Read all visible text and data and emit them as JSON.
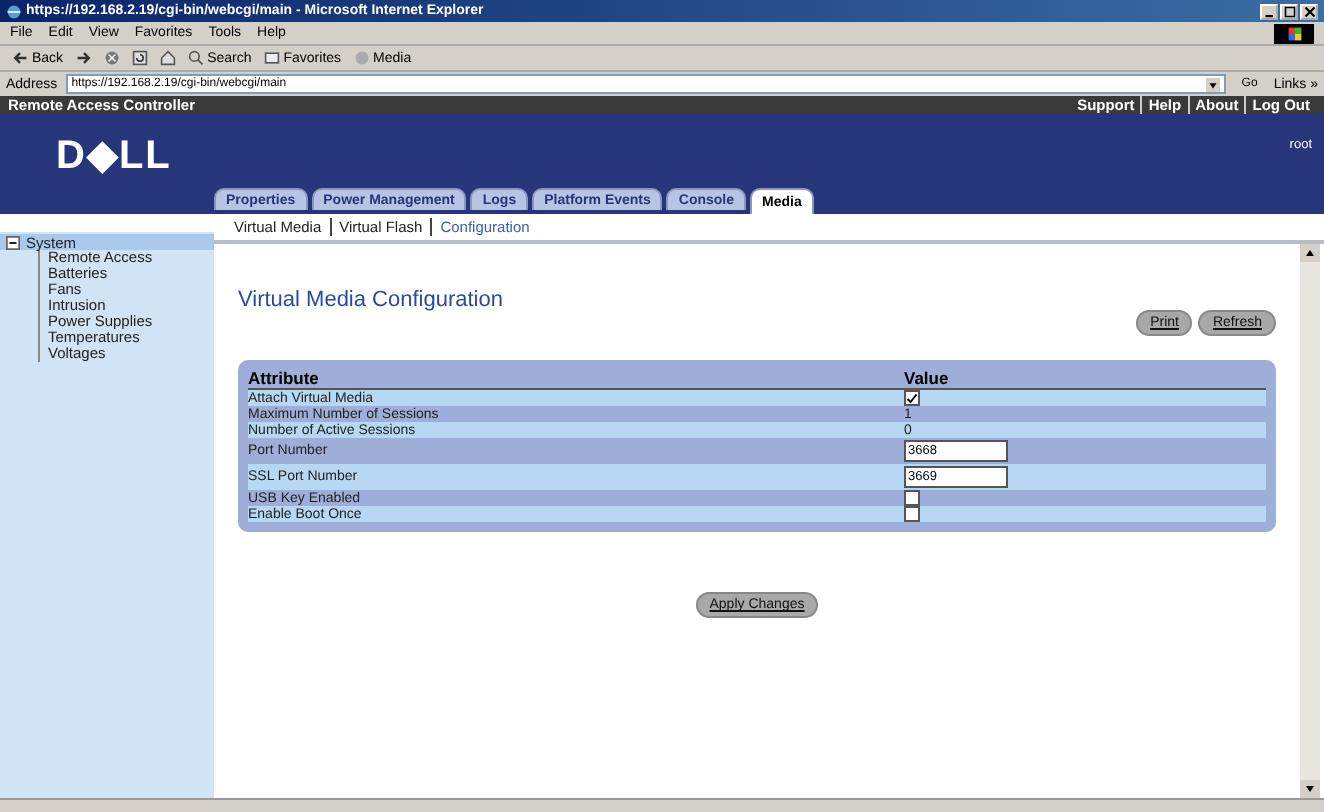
{
  "window": {
    "title": "https://192.168.2.19/cgi-bin/webcgi/main - Microsoft Internet Explorer"
  },
  "menu": [
    "File",
    "Edit",
    "View",
    "Favorites",
    "Tools",
    "Help"
  ],
  "toolbar": [
    {
      "label": "Back",
      "kind": "back"
    },
    {
      "kind": "forward"
    },
    {
      "kind": "stop"
    },
    {
      "kind": "refresh"
    },
    {
      "kind": "home"
    },
    {
      "label": "Search",
      "kind": "search"
    },
    {
      "label": "Favorites",
      "kind": "favorites"
    },
    {
      "label": "Media",
      "kind": "media"
    }
  ],
  "address": {
    "label": "Address",
    "value": "https://192.168.2.19/cgi-bin/webcgi/main",
    "go": "Go",
    "links": "Links »"
  },
  "app_bar": {
    "title": "Remote Access Controller",
    "links": [
      "Support",
      "Help",
      "About",
      "Log Out"
    ]
  },
  "header": {
    "logo": "D◆LL",
    "user": "root"
  },
  "tabs": [
    {
      "label": "Properties",
      "selected": false
    },
    {
      "label": "Power Management",
      "selected": false
    },
    {
      "label": "Logs",
      "selected": false
    },
    {
      "label": "Platform Events",
      "selected": false
    },
    {
      "label": "Console",
      "selected": false
    },
    {
      "label": "Media",
      "selected": true
    }
  ],
  "subtabs": [
    {
      "label": "Virtual Media",
      "selected": false
    },
    {
      "label": "Virtual Flash",
      "selected": false
    },
    {
      "label": "Configuration",
      "selected": true
    }
  ],
  "sidebar": {
    "items": [
      {
        "label": "System",
        "selected": true,
        "expanded": true,
        "children": [
          {
            "label": "Remote Access",
            "selected": false
          },
          {
            "label": "Batteries",
            "selected": false
          },
          {
            "label": "Fans",
            "selected": false
          },
          {
            "label": "Intrusion",
            "selected": false
          },
          {
            "label": "Power Supplies",
            "selected": false
          },
          {
            "label": "Temperatures",
            "selected": false
          },
          {
            "label": "Voltages",
            "selected": false
          }
        ]
      }
    ]
  },
  "page": {
    "title": "Virtual Media Configuration",
    "buttons": [
      "Print",
      "Refresh"
    ],
    "apply": "Apply Changes"
  },
  "table": {
    "columns": [
      "Attribute",
      "Value"
    ],
    "rows": [
      {
        "name": "Attach Virtual Media",
        "kind": "checkbox",
        "checked": true
      },
      {
        "name": "Maximum Number of Sessions",
        "kind": "text",
        "value": "1"
      },
      {
        "name": "Number of Active Sessions",
        "kind": "text",
        "value": "0"
      },
      {
        "name": "Port Number",
        "kind": "input",
        "value": "3668"
      },
      {
        "name": "SSL Port Number",
        "kind": "input",
        "value": "3669"
      },
      {
        "name": "USB Key Enabled",
        "kind": "checkbox",
        "checked": false
      },
      {
        "name": "Enable Boot Once",
        "kind": "checkbox",
        "checked": false
      }
    ]
  }
}
